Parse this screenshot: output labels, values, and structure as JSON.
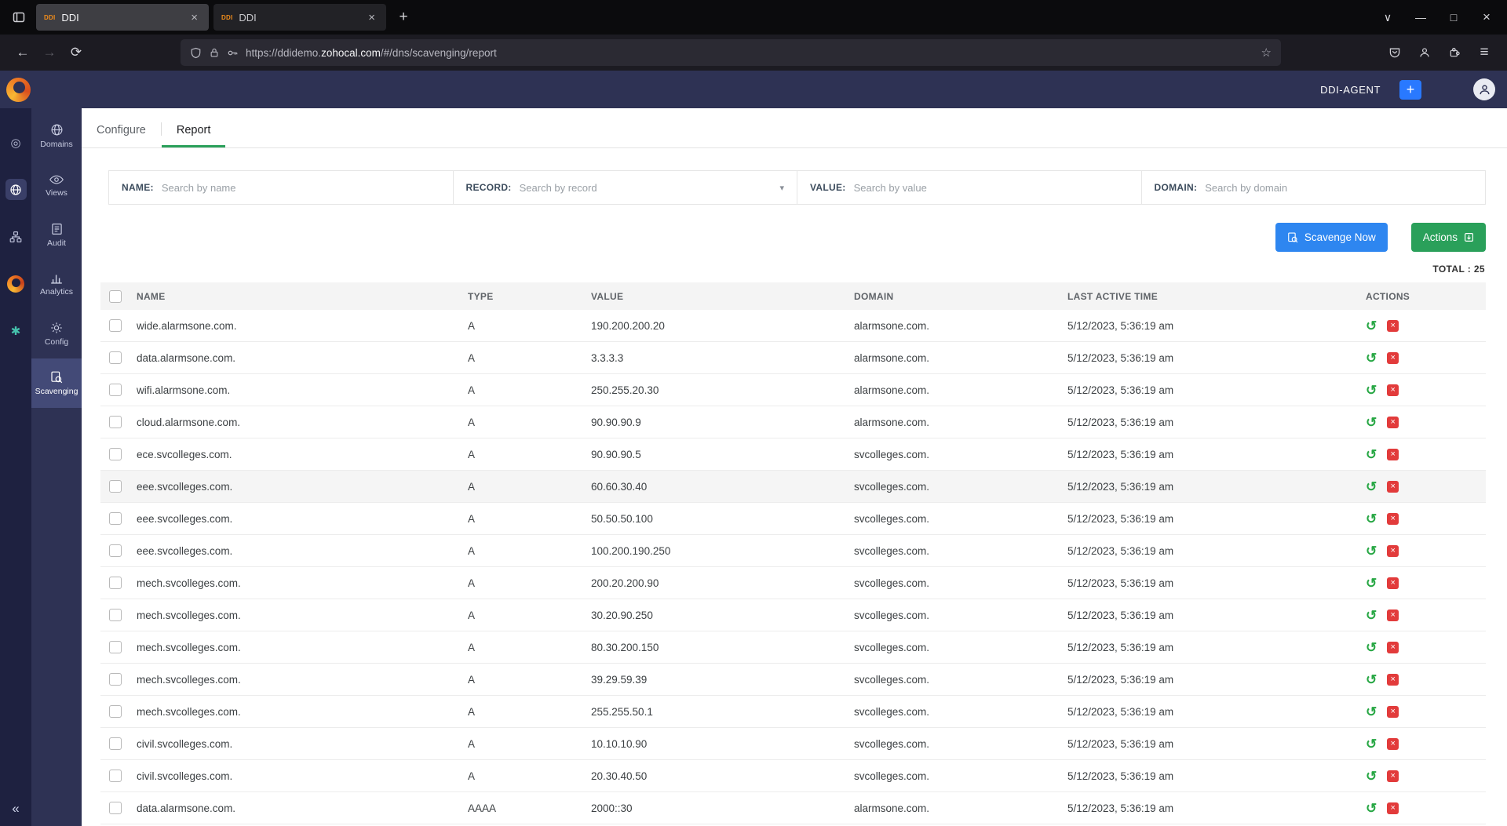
{
  "browser": {
    "tabs": [
      {
        "title": "DDI"
      },
      {
        "title": "DDI"
      }
    ],
    "favicon_text": "DDI",
    "url": {
      "prefix": "https://ddidemo.",
      "domain": "zohocal.com",
      "path": "/#/dns/scavenging/report"
    }
  },
  "header": {
    "agent_label": "DDI-AGENT"
  },
  "sidebar": {
    "items": [
      {
        "label": "Domains"
      },
      {
        "label": "Views"
      },
      {
        "label": "Audit"
      },
      {
        "label": "Analytics"
      },
      {
        "label": "Config"
      },
      {
        "label": "Scavenging"
      }
    ]
  },
  "module_tabs": [
    {
      "label": "Configure"
    },
    {
      "label": "Report"
    }
  ],
  "filters": [
    {
      "label": "NAME:",
      "placeholder": "Search by name"
    },
    {
      "label": "RECORD:",
      "placeholder": "Search by record"
    },
    {
      "label": "VALUE:",
      "placeholder": "Search by value"
    },
    {
      "label": "DOMAIN:",
      "placeholder": "Search by domain"
    }
  ],
  "toolbar": {
    "scavenge_label": "Scavenge Now",
    "actions_label": "Actions"
  },
  "total_label": "TOTAL : 25",
  "table": {
    "columns": [
      "NAME",
      "TYPE",
      "VALUE",
      "DOMAIN",
      "LAST ACTIVE TIME",
      "ACTIONS"
    ],
    "rows": [
      {
        "name": "wide.alarmsone.com.",
        "type": "A",
        "value": "190.200.200.20",
        "domain": "alarmsone.com.",
        "time": "5/12/2023, 5:36:19 am"
      },
      {
        "name": "data.alarmsone.com.",
        "type": "A",
        "value": "3.3.3.3",
        "domain": "alarmsone.com.",
        "time": "5/12/2023, 5:36:19 am"
      },
      {
        "name": "wifi.alarmsone.com.",
        "type": "A",
        "value": "250.255.20.30",
        "domain": "alarmsone.com.",
        "time": "5/12/2023, 5:36:19 am"
      },
      {
        "name": "cloud.alarmsone.com.",
        "type": "A",
        "value": "90.90.90.9",
        "domain": "alarmsone.com.",
        "time": "5/12/2023, 5:36:19 am"
      },
      {
        "name": "ece.svcolleges.com.",
        "type": "A",
        "value": "90.90.90.5",
        "domain": "svcolleges.com.",
        "time": "5/12/2023, 5:36:19 am"
      },
      {
        "name": "eee.svcolleges.com.",
        "type": "A",
        "value": "60.60.30.40",
        "domain": "svcolleges.com.",
        "time": "5/12/2023, 5:36:19 am",
        "state": "highlight"
      },
      {
        "name": "eee.svcolleges.com.",
        "type": "A",
        "value": "50.50.50.100",
        "domain": "svcolleges.com.",
        "time": "5/12/2023, 5:36:19 am"
      },
      {
        "name": "eee.svcolleges.com.",
        "type": "A",
        "value": "100.200.190.250",
        "domain": "svcolleges.com.",
        "time": "5/12/2023, 5:36:19 am"
      },
      {
        "name": "mech.svcolleges.com.",
        "type": "A",
        "value": "200.20.200.90",
        "domain": "svcolleges.com.",
        "time": "5/12/2023, 5:36:19 am"
      },
      {
        "name": "mech.svcolleges.com.",
        "type": "A",
        "value": "30.20.90.250",
        "domain": "svcolleges.com.",
        "time": "5/12/2023, 5:36:19 am"
      },
      {
        "name": "mech.svcolleges.com.",
        "type": "A",
        "value": "80.30.200.150",
        "domain": "svcolleges.com.",
        "time": "5/12/2023, 5:36:19 am"
      },
      {
        "name": "mech.svcolleges.com.",
        "type": "A",
        "value": "39.29.59.39",
        "domain": "svcolleges.com.",
        "time": "5/12/2023, 5:36:19 am"
      },
      {
        "name": "mech.svcolleges.com.",
        "type": "A",
        "value": "255.255.50.1",
        "domain": "svcolleges.com.",
        "time": "5/12/2023, 5:36:19 am"
      },
      {
        "name": "civil.svcolleges.com.",
        "type": "A",
        "value": "10.10.10.90",
        "domain": "svcolleges.com.",
        "time": "5/12/2023, 5:36:19 am"
      },
      {
        "name": "civil.svcolleges.com.",
        "type": "A",
        "value": "20.30.40.50",
        "domain": "svcolleges.com.",
        "time": "5/12/2023, 5:36:19 am"
      },
      {
        "name": "data.alarmsone.com.",
        "type": "AAAA",
        "value": "2000::30",
        "domain": "alarmsone.com.",
        "time": "5/12/2023, 5:36:19 am"
      }
    ]
  }
}
